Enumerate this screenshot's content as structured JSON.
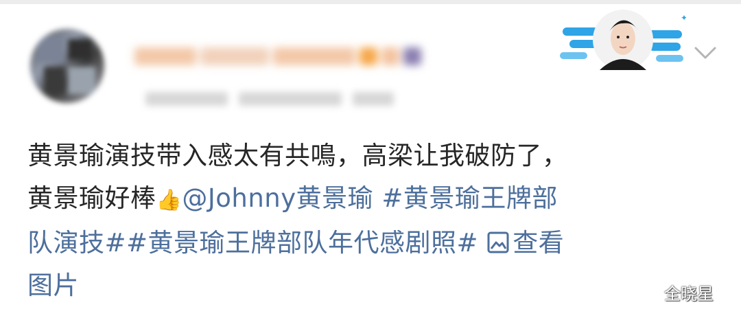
{
  "post": {
    "author": {
      "display_name": "",
      "timestamp": ""
    },
    "text_line1": "黄景瑜演技带入感太有共鳴，高梁让我破防了，",
    "text_line2_plain": "黄景瑜好棒",
    "thumb_emoji": "👍",
    "mention": "@Johnny黄景瑜",
    "hashtag1_part1": " #黄景瑜王牌部",
    "hashtag1_part2": "队演技#",
    "hashtag2": "#黄景瑜王牌部队年代感剧照#",
    "view_image_part1": "查看",
    "view_image_part2": "图片"
  },
  "watermark": "全晓星",
  "colors": {
    "link": "#4d6f9c",
    "text": "#262626"
  },
  "icons": {
    "dropdown": "chevron-down-icon",
    "view_image": "image-icon"
  }
}
